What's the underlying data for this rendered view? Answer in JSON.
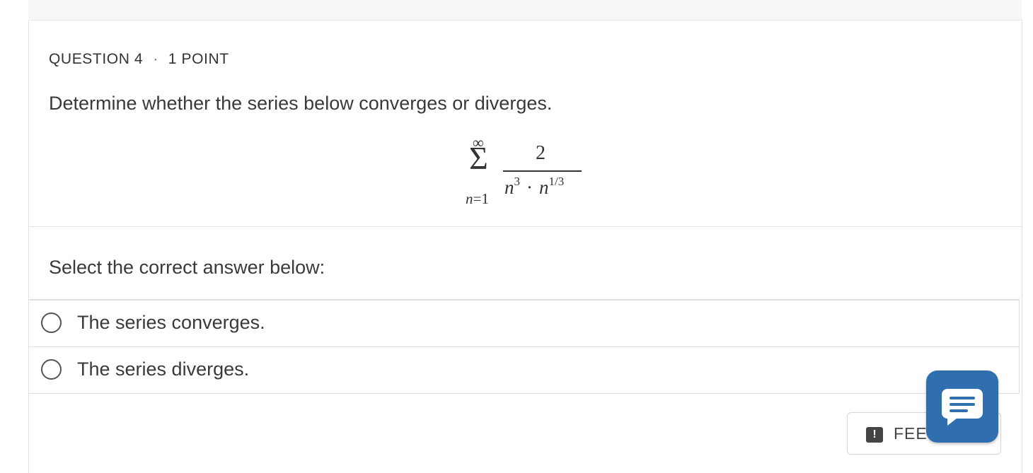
{
  "question": {
    "number_label": "QUESTION 4",
    "points_label": "1 POINT",
    "separator": "·",
    "prompt": "Determine whether the series below converges or diverges."
  },
  "series": {
    "upper_limit": "∞",
    "sigma": "Σ",
    "index_var": "n",
    "lower_limit": "=1",
    "numerator": "2",
    "denominator_base_1": "n",
    "denominator_exp_1": "3",
    "operator": "·",
    "denominator_base_2": "n",
    "denominator_exp_2": "1/3"
  },
  "answer_section": {
    "label": "Select the correct answer below:",
    "options": [
      {
        "label": "The series converges.",
        "selected": false
      },
      {
        "label": "The series diverges.",
        "selected": false
      }
    ]
  },
  "feedback": {
    "label": "FEE",
    "icon": "exclamation-icon"
  },
  "chat": {
    "icon": "chat-bubble-icon",
    "color": "#2f6fb0"
  }
}
